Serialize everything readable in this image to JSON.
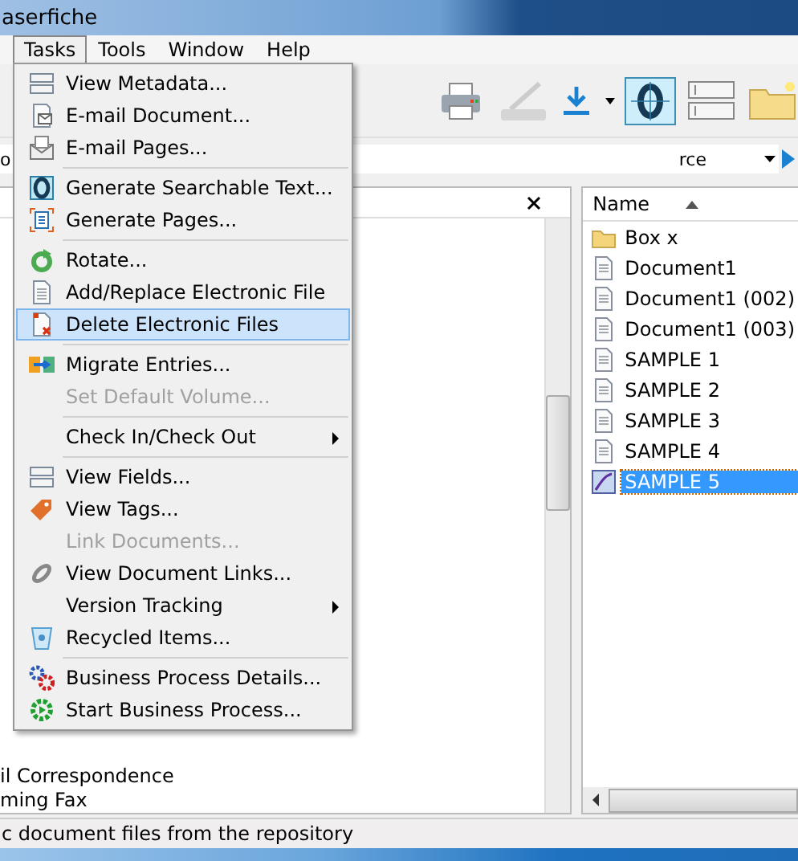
{
  "window": {
    "title": "aserfiche"
  },
  "menubar": [
    {
      "label": "Tasks",
      "selected": true
    },
    {
      "label": "Tools",
      "selected": false
    },
    {
      "label": "Window",
      "selected": false
    },
    {
      "label": "Help",
      "selected": false
    }
  ],
  "toolbar": [
    {
      "kind": "printer",
      "disabled": false,
      "selected": false
    },
    {
      "kind": "scanner",
      "disabled": true,
      "selected": false
    },
    {
      "kind": "download",
      "disabled": false,
      "selected": false
    },
    {
      "kind": "ocr",
      "disabled": false,
      "selected": true
    },
    {
      "kind": "fields",
      "disabled": false,
      "selected": false
    },
    {
      "kind": "new-folder",
      "disabled": false,
      "selected": false
    }
  ],
  "address_bar": {
    "prefix": "o",
    "value": "rce"
  },
  "tree": {
    "items": [
      "il Correspondence",
      "ming Fax"
    ]
  },
  "file_list": {
    "column": "Name",
    "items": [
      {
        "kind": "folder",
        "name": "Box x",
        "selected": false
      },
      {
        "kind": "document",
        "name": "Document1",
        "selected": false
      },
      {
        "kind": "document",
        "name": "Document1 (002)",
        "selected": false
      },
      {
        "kind": "document",
        "name": "Document1 (003)",
        "selected": false
      },
      {
        "kind": "document",
        "name": "SAMPLE 1",
        "selected": false
      },
      {
        "kind": "document",
        "name": "SAMPLE 2",
        "selected": false
      },
      {
        "kind": "document",
        "name": "SAMPLE 3",
        "selected": false
      },
      {
        "kind": "document",
        "name": "SAMPLE 4",
        "selected": false
      },
      {
        "kind": "pdf",
        "name": "SAMPLE 5",
        "selected": true
      }
    ]
  },
  "menu": [
    {
      "kind": "metadata",
      "label": "View Metadata...",
      "disabled": false,
      "selected": false,
      "submenu": false
    },
    {
      "kind": "email",
      "label": "E-mail Document...",
      "disabled": false,
      "selected": false,
      "submenu": false
    },
    {
      "kind": "envelope",
      "label": "E-mail Pages...",
      "disabled": false,
      "selected": false,
      "submenu": false
    },
    {
      "kind": "separator"
    },
    {
      "kind": "ocr",
      "label": "Generate Searchable Text...",
      "disabled": false,
      "selected": false,
      "submenu": false
    },
    {
      "kind": "pages",
      "label": "Generate Pages...",
      "disabled": false,
      "selected": false,
      "submenu": false
    },
    {
      "kind": "separator"
    },
    {
      "kind": "rotate",
      "label": "Rotate...",
      "disabled": false,
      "selected": false,
      "submenu": false
    },
    {
      "kind": "file",
      "label": "Add/Replace Electronic File",
      "disabled": false,
      "selected": false,
      "submenu": false
    },
    {
      "kind": "delete",
      "label": "Delete Electronic Files",
      "disabled": false,
      "selected": true,
      "submenu": false
    },
    {
      "kind": "separator"
    },
    {
      "kind": "migrate",
      "label": "Migrate Entries...",
      "disabled": false,
      "selected": false,
      "submenu": false
    },
    {
      "kind": "plain",
      "label": "Set Default Volume...",
      "disabled": true,
      "selected": false,
      "submenu": false
    },
    {
      "kind": "separator"
    },
    {
      "kind": "plain",
      "label": "Check In/Check Out",
      "disabled": false,
      "selected": false,
      "submenu": true
    },
    {
      "kind": "separator"
    },
    {
      "kind": "metadata",
      "label": "View Fields...",
      "disabled": false,
      "selected": false,
      "submenu": false
    },
    {
      "kind": "tag",
      "label": "View Tags...",
      "disabled": false,
      "selected": false,
      "submenu": false
    },
    {
      "kind": "plain",
      "label": "Link Documents...",
      "disabled": true,
      "selected": false,
      "submenu": false
    },
    {
      "kind": "link",
      "label": "View Document Links...",
      "disabled": false,
      "selected": false,
      "submenu": false
    },
    {
      "kind": "plain",
      "label": "Version Tracking",
      "disabled": false,
      "selected": false,
      "submenu": true
    },
    {
      "kind": "recycle",
      "label": "Recycled Items...",
      "disabled": false,
      "selected": false,
      "submenu": false
    },
    {
      "kind": "separator"
    },
    {
      "kind": "gears",
      "label": "Business Process Details...",
      "disabled": false,
      "selected": false,
      "submenu": false
    },
    {
      "kind": "start",
      "label": "Start Business Process...",
      "disabled": false,
      "selected": false,
      "submenu": false
    }
  ],
  "status_bar": {
    "text": "c document files from the repository"
  }
}
